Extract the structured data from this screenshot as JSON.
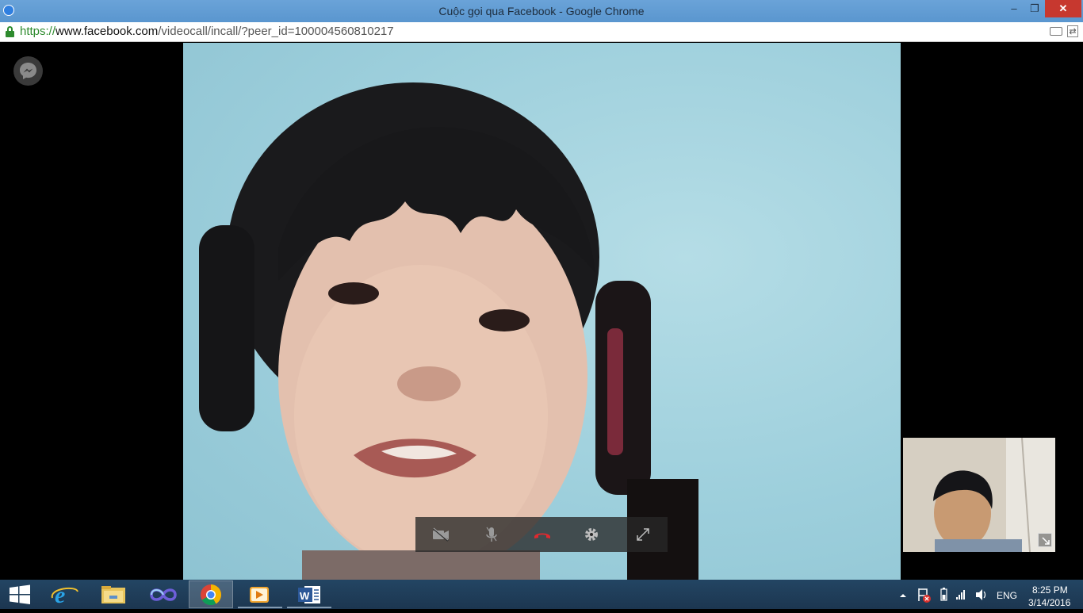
{
  "window": {
    "title": "Cuộc gọi qua Facebook - Google Chrome",
    "controls": {
      "minimize": "–",
      "maximize": "❐",
      "close": "✕"
    }
  },
  "address_bar": {
    "scheme": "https://",
    "host": "www.facebook.com",
    "path": "/videocall/incall/?peer_id=100004560810217"
  },
  "call": {
    "controls": [
      "camera-off",
      "microphone",
      "end-call",
      "settings",
      "fullscreen"
    ],
    "end_call_color": "#e0292f"
  },
  "taskbar": {
    "apps": [
      "windows-start",
      "internet-explorer",
      "file-explorer",
      "app-infinity",
      "google-chrome",
      "media-player",
      "microsoft-word"
    ],
    "language": "ENG",
    "time": "8:25 PM",
    "date": "3/14/2016"
  },
  "colors": {
    "titlebar": "#5a96cf",
    "taskbar": "#1f3b56",
    "https_green": "#2e8b2e"
  }
}
